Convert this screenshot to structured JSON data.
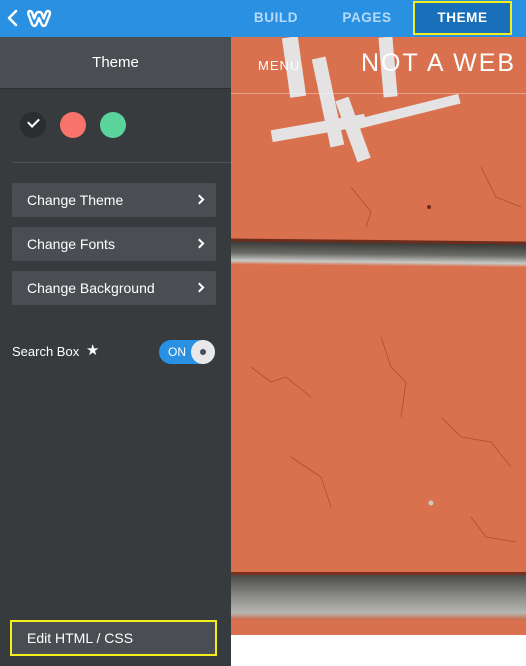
{
  "topbar": {
    "back_icon": "chevron-left-icon",
    "logo_icon": "weebly-logo",
    "tabs": [
      {
        "label": "BUILD",
        "active": false
      },
      {
        "label": "PAGES",
        "active": false
      },
      {
        "label": "THEME",
        "active": true
      }
    ]
  },
  "sidebar": {
    "title": "Theme",
    "swatches": [
      {
        "color": "#2b2e30",
        "selected": true
      },
      {
        "color": "#f8746a",
        "selected": false
      },
      {
        "color": "#5bd49b",
        "selected": false
      }
    ],
    "menu_items": [
      {
        "label": "Change Theme"
      },
      {
        "label": "Change Fonts"
      },
      {
        "label": "Change Background"
      }
    ],
    "search_box": {
      "label": "Search Box",
      "star_icon": "star-icon",
      "toggle_label": "ON",
      "enabled": true
    },
    "edit_button": "Edit HTML / CSS"
  },
  "preview": {
    "menu_label": "MENU",
    "site_title": "NOT A WEB"
  },
  "colors": {
    "accent": "#2a91e2",
    "active_tab": "#1a6fba",
    "highlight": "#f4ee1a",
    "sidebar_bg": "#373b3e",
    "button_bg": "#4a4e52"
  }
}
